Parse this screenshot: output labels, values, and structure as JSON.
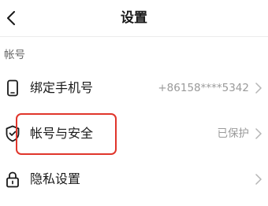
{
  "header": {
    "title": "设置",
    "back_icon": "chevron-left-icon"
  },
  "section": {
    "title": "帐号"
  },
  "rows": [
    {
      "icon": "phone-icon",
      "label": "绑定手机号",
      "value": "+86158****5342"
    },
    {
      "icon": "shield-icon",
      "label": "帐号与安全",
      "value": "已保护"
    },
    {
      "icon": "lock-icon",
      "label": "隐私设置",
      "value": ""
    }
  ],
  "annotation": {
    "highlight_color": "#e0352b",
    "highlighted_row": "帐号与安全"
  },
  "colors": {
    "text_primary": "#1a1a1a",
    "text_secondary": "#9a9a9a",
    "section_header": "#666666",
    "chevron": "#b5b5b5"
  }
}
